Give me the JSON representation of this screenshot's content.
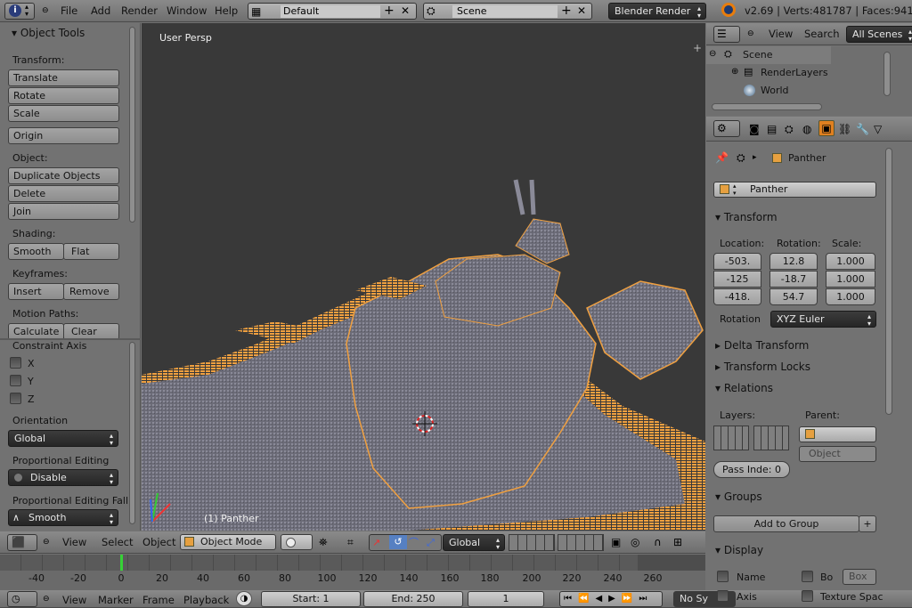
{
  "topbar": {
    "menus": [
      "File",
      "Add",
      "Render",
      "Window",
      "Help"
    ],
    "layout": "Default",
    "scene": "Scene",
    "engine": "Blender Render",
    "stats": "v2.69 | Verts:481787 | Faces:941"
  },
  "toolshelf": {
    "title": "Object Tools",
    "transform_label": "Transform:",
    "translate": "Translate",
    "rotate": "Rotate",
    "scale": "Scale",
    "origin": "Origin",
    "object_label": "Object:",
    "duplicate": "Duplicate Objects",
    "delete": "Delete",
    "join": "Join",
    "shading_label": "Shading:",
    "smooth": "Smooth",
    "flat": "Flat",
    "keyframes_label": "Keyframes:",
    "insert": "Insert",
    "remove": "Remove",
    "motion_label": "Motion Paths:",
    "calculate": "Calculate",
    "clear": "Clear"
  },
  "operator": {
    "constraint_label": "Constraint Axis",
    "axes": [
      "X",
      "Y",
      "Z"
    ],
    "orientation_label": "Orientation",
    "orientation": "Global",
    "prop_label": "Proportional Editing",
    "prop_value": "Disable",
    "falloff_label": "Proportional Editing Fall",
    "falloff_value": "Smooth"
  },
  "viewport": {
    "view_name": "User Persp",
    "object_name": "(1) Panther"
  },
  "view3d_header": {
    "menus": [
      "View",
      "Select",
      "Object"
    ],
    "mode": "Object Mode",
    "orientation": "Global"
  },
  "timeline": {
    "ticks": [
      "-40",
      "-20",
      "0",
      "20",
      "40",
      "60",
      "80",
      "100",
      "120",
      "140",
      "160",
      "180",
      "200",
      "220",
      "240",
      "260"
    ],
    "menus": [
      "View",
      "Marker",
      "Frame",
      "Playback"
    ],
    "start": "Start: 1",
    "end": "End: 250",
    "current": "1",
    "sync": "No Sy"
  },
  "outliner": {
    "menus": [
      "View",
      "Search"
    ],
    "filter": "All Scenes",
    "items": [
      "Scene",
      "RenderLayers",
      "World"
    ]
  },
  "properties": {
    "breadcrumb": "Panther",
    "object_name": "Panther",
    "transform_title": "Transform",
    "location_label": "Location:",
    "rotation_label": "Rotation:",
    "scale_label": "Scale:",
    "location": [
      "-503.",
      "-125",
      "-418."
    ],
    "rotation": [
      "12.8",
      "-18.7",
      "54.7"
    ],
    "scale": [
      "1.000",
      "1.000",
      "1.000"
    ],
    "rotation_mode_label": "Rotation",
    "rotation_mode": "XYZ Euler",
    "delta_transform": "Delta Transform",
    "transform_locks": "Transform Locks",
    "relations": "Relations",
    "layers_label": "Layers:",
    "parent_label": "Parent:",
    "parent_type": "Object",
    "pass_index": "Pass Inde: 0",
    "groups": "Groups",
    "add_to_group": "Add to Group",
    "display": "Display",
    "display_name": "Name",
    "display_bo": "Bo",
    "display_box": "Box",
    "display_axis": "Axis",
    "display_texture": "Texture Spac"
  },
  "colors": {
    "viewport_bg": "#393939",
    "selection_orange": "#f0a040",
    "panel_bg": "#727272",
    "active_tab": "#e08020"
  }
}
